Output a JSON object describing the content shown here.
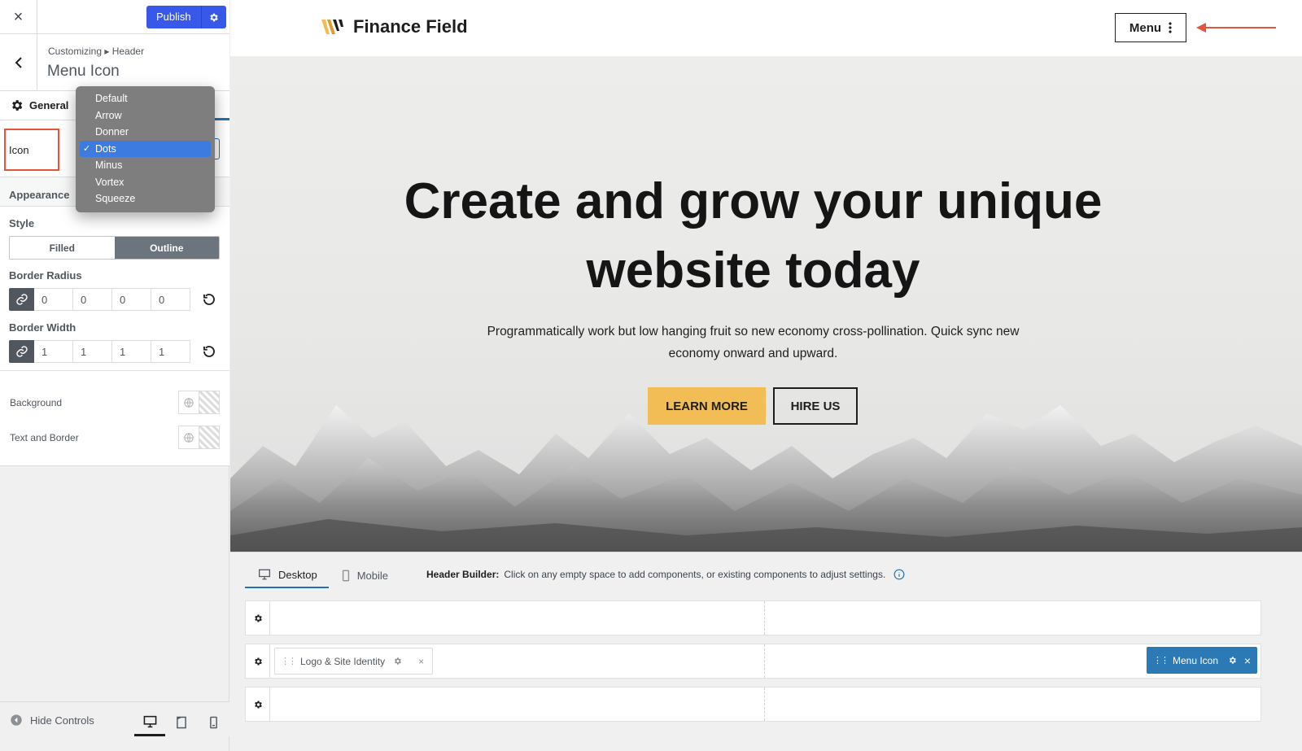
{
  "topbar": {
    "close_icon": "×",
    "publish_label": "Publish"
  },
  "section": {
    "breadcrumb": "Customizing ▸ Header",
    "title": "Menu Icon"
  },
  "tabs": {
    "general_label": "General"
  },
  "icon_field": {
    "label": "Icon",
    "options": [
      "Default",
      "Arrow",
      "Donner",
      "Dots",
      "Minus",
      "Vortex",
      "Squeeze"
    ],
    "selected": "Dots"
  },
  "design": {
    "appearance_label": "Appearance",
    "style_label": "Style",
    "style_options": [
      "Filled",
      "Outline"
    ],
    "style_selected": "Outline",
    "border_radius_label": "Border Radius",
    "border_radius": [
      "0",
      "0",
      "0",
      "0"
    ],
    "border_width_label": "Border Width",
    "border_width": [
      "1",
      "1",
      "1",
      "1"
    ],
    "background_label": "Background",
    "text_border_label": "Text and Border"
  },
  "footer": {
    "hide_controls": "Hide Controls"
  },
  "preview": {
    "site_name": "Finance Field",
    "menu_label": "Menu",
    "hero_title": "Create and grow your unique website today",
    "hero_subtitle": "Programmatically work but low hanging fruit so new economy cross-pollination. Quick sync new economy onward and upward.",
    "learn_more": "LEARN MORE",
    "hire_us": "HIRE US"
  },
  "builder": {
    "tab_desktop": "Desktop",
    "tab_mobile": "Mobile",
    "help_title": "Header Builder:",
    "help_text": "Click on any empty space to add components, or existing components to adjust settings.",
    "chip_logo": "Logo & Site Identity",
    "chip_menu": "Menu Icon"
  },
  "colors": {
    "accent": "#3858e9",
    "annotation": "#e5533d",
    "button_yellow": "#f2bd54",
    "chip_blue": "#2c7ab5"
  }
}
